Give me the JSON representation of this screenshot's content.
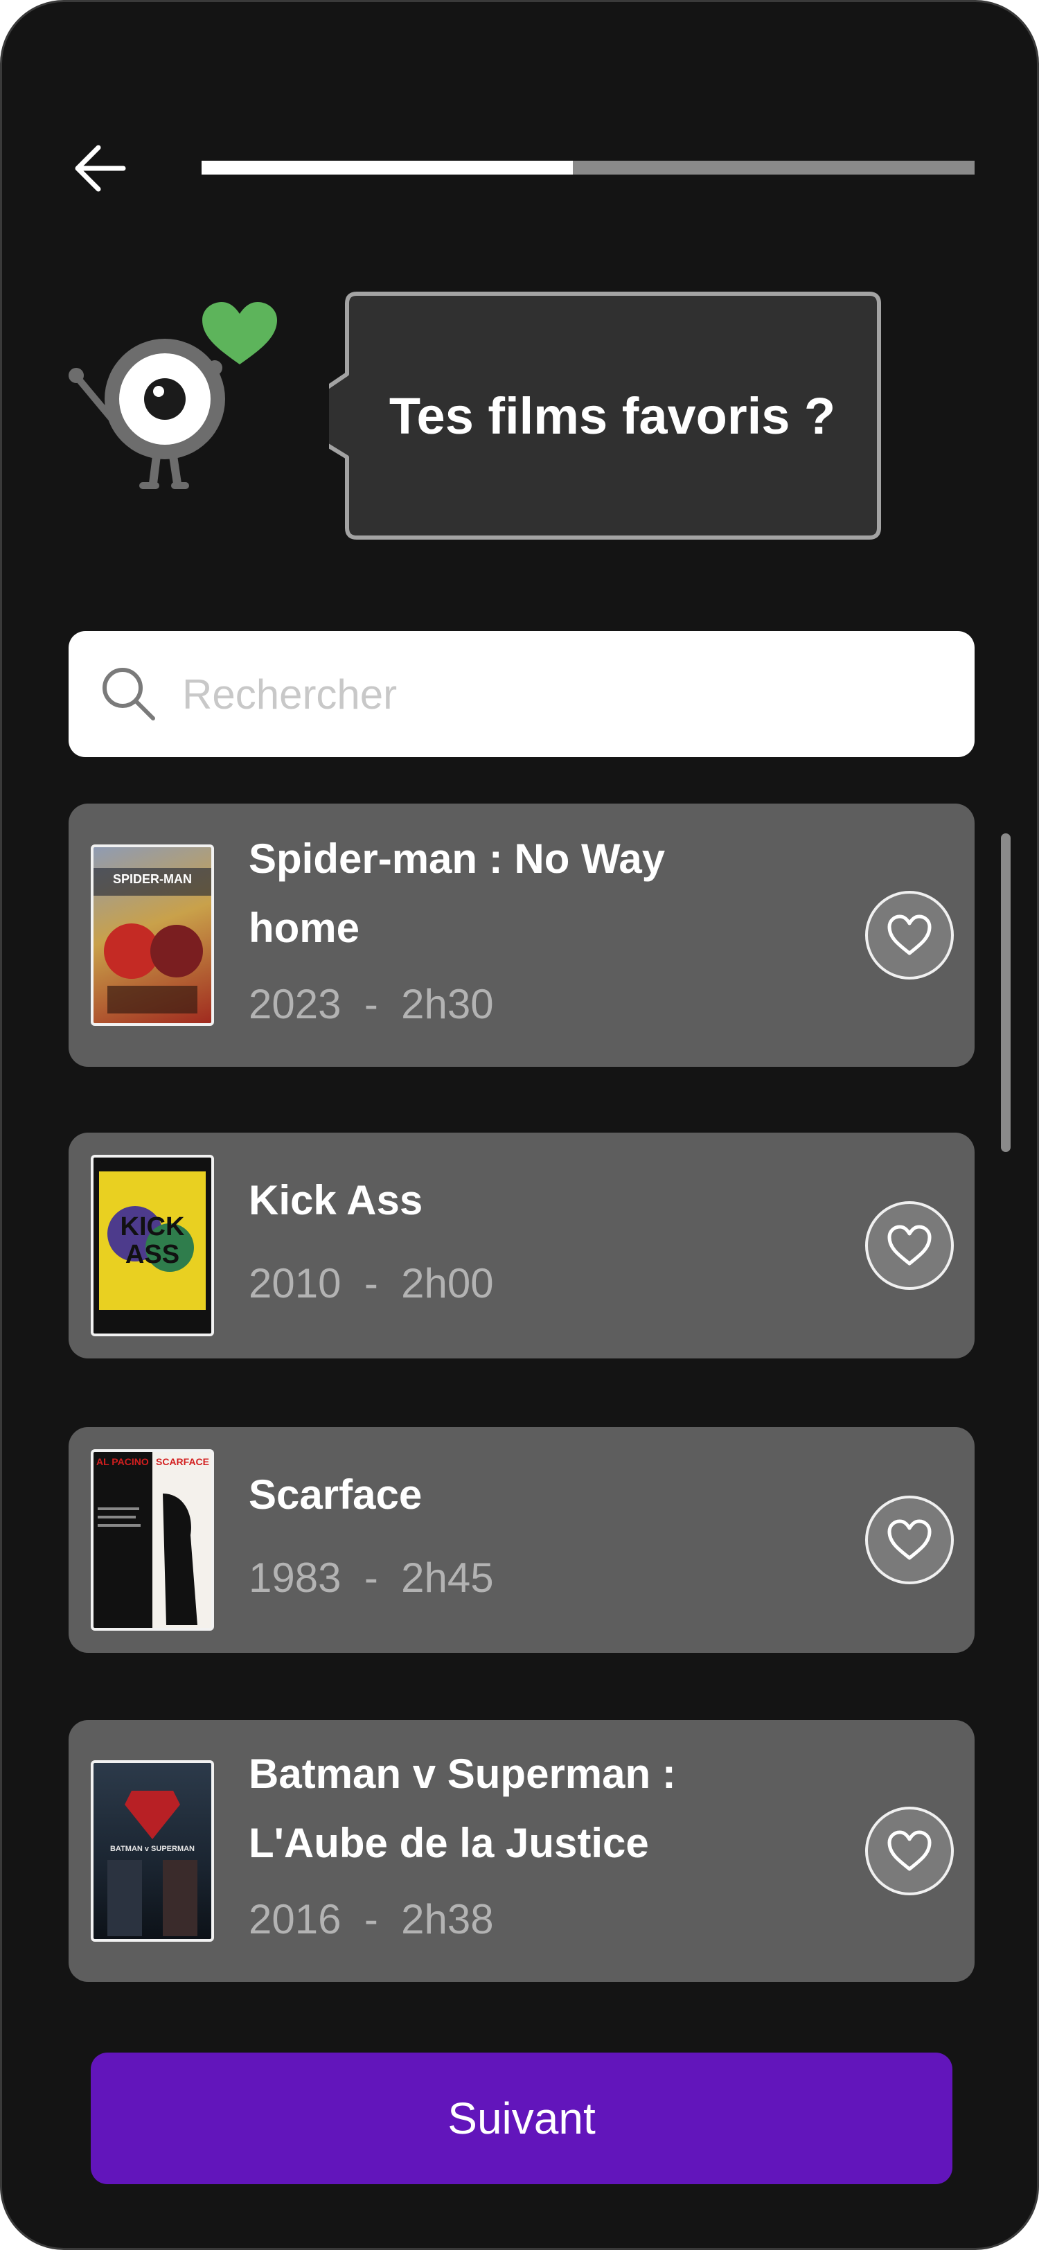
{
  "header": {
    "back_icon": "arrow-left-icon",
    "progress_fraction": 0.48
  },
  "prompt": {
    "text": "Tes films favoris ?",
    "mascot_accent": "#5db45b"
  },
  "search": {
    "placeholder": "Rechercher",
    "value": ""
  },
  "movies": [
    {
      "title": "Spider-man : No Way home",
      "year": "2023",
      "duration": "2h30"
    },
    {
      "title": "Kick Ass",
      "year": "2010",
      "duration": "2h00"
    },
    {
      "title": "Scarface",
      "year": "1983",
      "duration": "2h45"
    },
    {
      "title": "Batman v Superman : L'Aube de la Justice",
      "year": "2016",
      "duration": "2h38"
    }
  ],
  "posters": {
    "spiderman": {
      "wordmark": "SPIDER-MAN"
    },
    "kickass": {
      "wordmark": "KICK ASS"
    },
    "scarface": {
      "left": "AL PACINO",
      "right": "SCARFACE"
    },
    "batman": {
      "wordmark": "BATMAN v SUPERMAN"
    }
  },
  "footer": {
    "next_label": "Suivant"
  },
  "colors": {
    "background": "#141414",
    "card": "#5e5e5e",
    "accent": "#6215bb"
  }
}
